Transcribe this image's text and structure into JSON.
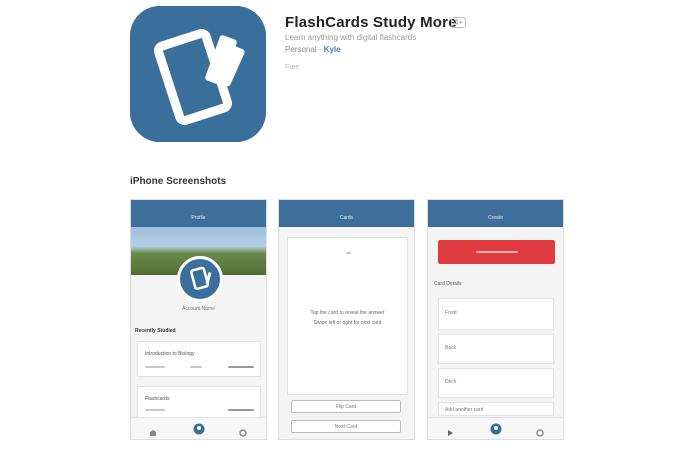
{
  "app": {
    "title": "FlashCards Study More",
    "age_badge": "4+",
    "subtitle": "Learn anything with digital flashcards",
    "developer_prefix": "Personal · ",
    "developer_link": "Kyle",
    "meta": "Free"
  },
  "section_title": "iPhone Screenshots",
  "screens": [
    {
      "nav_title": "Profile",
      "caption": "Account Name",
      "heading": "Recently Studied",
      "item_1": "Introduction to Biology",
      "item_2": "Flashcards"
    },
    {
      "nav_title": "Cards",
      "body_1": "Tap the card to reveal the answer",
      "body_2": "Swipe left or right for next card",
      "btn_1": "Flip Card",
      "btn_2": "Next Card"
    },
    {
      "nav_title": "Create",
      "heading": "Card Details",
      "field_1": "Front",
      "field_2": "Back",
      "field_3": "Deck",
      "field_4": "Add another card"
    }
  ],
  "colors": {
    "brand": "#3a6f9c",
    "nav": "#3d6f9a",
    "accent_red": "#e03b40",
    "link": "#3d7fc1"
  },
  "icons": [
    "flashcards-app-icon",
    "card-icon",
    "home-icon",
    "profile-icon",
    "settings-icon",
    "back-icon"
  ]
}
